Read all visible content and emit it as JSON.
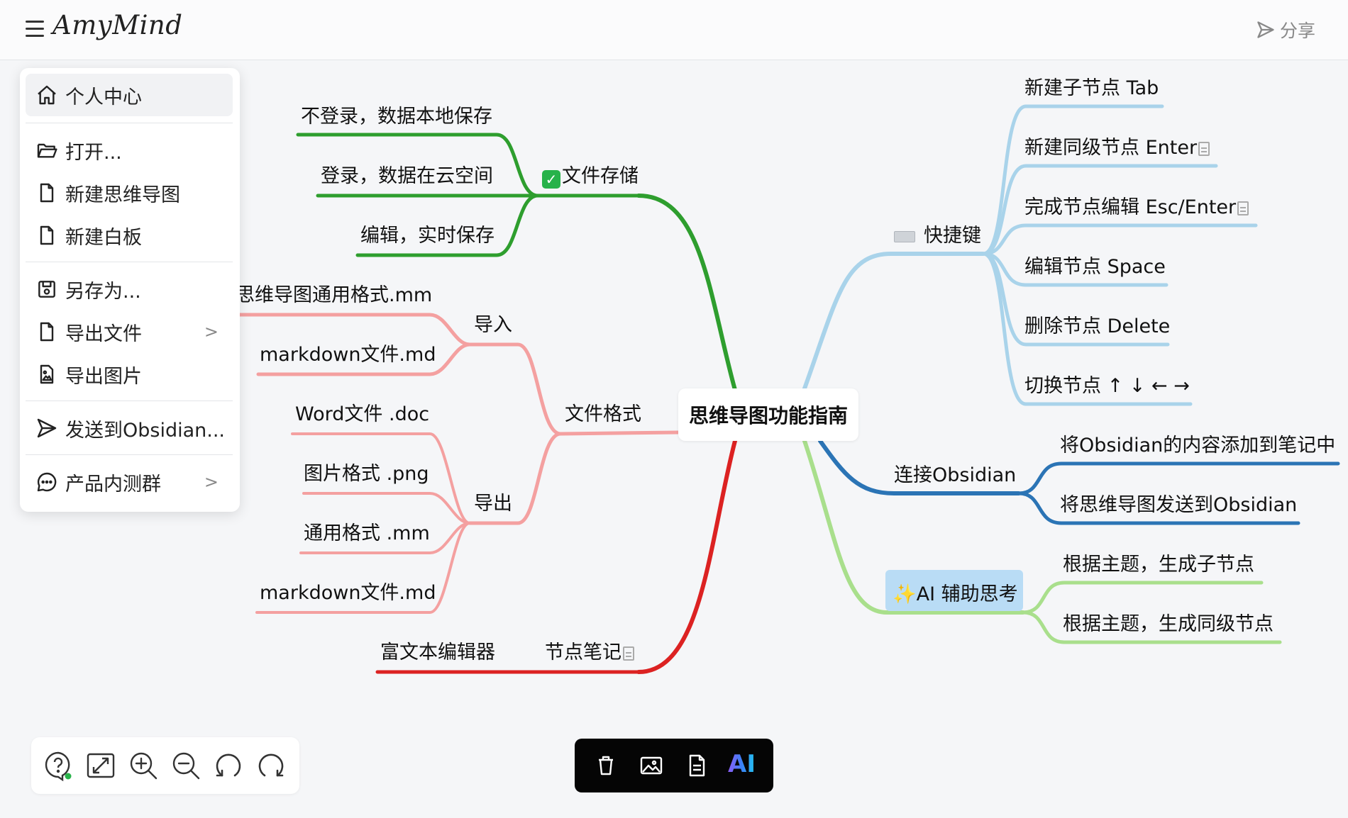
{
  "header": {
    "logo": "AmyMind",
    "share_label": "分享"
  },
  "menu": {
    "items": [
      {
        "label": "个人中心"
      },
      {
        "label": "打开..."
      },
      {
        "label": "新建思维导图"
      },
      {
        "label": "新建白板"
      },
      {
        "label": "另存为..."
      },
      {
        "label": "导出文件"
      },
      {
        "label": "导出图片"
      },
      {
        "label": "发送到Obsidian..."
      },
      {
        "label": "产品内测群"
      }
    ]
  },
  "mindmap": {
    "root": "思维导图功能指南",
    "storage": {
      "label": "文件存储",
      "children": [
        "不登录，数据本地保存",
        "登录，数据在云空间",
        "编辑，实时保存"
      ]
    },
    "format": {
      "label": "文件格式",
      "import": {
        "label": "导入",
        "children": [
          "思维导图通用格式.mm",
          "markdown文件.md"
        ]
      },
      "export": {
        "label": "导出",
        "children": [
          "Word文件 .doc",
          "图片格式 .png",
          "通用格式 .mm",
          "markdown文件.md"
        ]
      }
    },
    "notes": {
      "label": "节点笔记",
      "children": [
        "富文本编辑器"
      ]
    },
    "shortcuts": {
      "label": "快捷键",
      "children": [
        "新建子节点 Tab",
        "新建同级节点 Enter",
        "完成节点编辑 Esc/Enter",
        "编辑节点 Space",
        "删除节点 Delete",
        "切换节点 ↑ ↓ ← →"
      ]
    },
    "obsidian": {
      "label": "连接Obsidian",
      "children": [
        "将Obsidian的内容添加到笔记中",
        "将思维导图发送到Obsidian"
      ]
    },
    "ai": {
      "label": "AI 辅助思考",
      "sparkle": "✨",
      "children": [
        "根据主题，生成子节点",
        "根据主题，生成同级节点"
      ]
    }
  },
  "bottom_center": {
    "ai_label": "AI"
  },
  "colors": {
    "storage": "#2e9e2e",
    "format": "#f4a0a0",
    "notes": "#dc2222",
    "shortcuts": "#a9d3ea",
    "obsidian": "#2b74b5",
    "ai": "#a9df8c"
  }
}
